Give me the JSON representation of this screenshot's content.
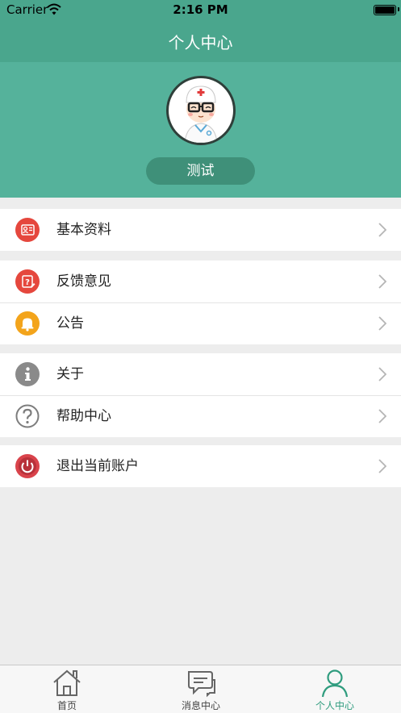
{
  "status_bar": {
    "carrier": "Carrier",
    "time": "2:16 PM"
  },
  "nav": {
    "title": "个人中心"
  },
  "profile": {
    "name": "测试"
  },
  "menu": {
    "group1": [
      {
        "label": "基本资料",
        "icon": "profile-card-icon"
      }
    ],
    "group2": [
      {
        "label": "反馈意见",
        "icon": "feedback-icon"
      },
      {
        "label": "公告",
        "icon": "bell-icon"
      }
    ],
    "group3": [
      {
        "label": "关于",
        "icon": "info-icon"
      },
      {
        "label": "帮助中心",
        "icon": "help-icon"
      }
    ],
    "group4": [
      {
        "label": "退出当前账户",
        "icon": "power-icon"
      }
    ]
  },
  "tabbar": {
    "tabs": [
      {
        "label": "首页",
        "icon": "home-icon"
      },
      {
        "label": "消息中心",
        "icon": "message-icon"
      },
      {
        "label": "个人中心",
        "icon": "person-icon"
      }
    ],
    "active_index": 2
  },
  "colors": {
    "header": "#55b29b",
    "accent": "#2f9c7e",
    "background": "#ededed"
  }
}
